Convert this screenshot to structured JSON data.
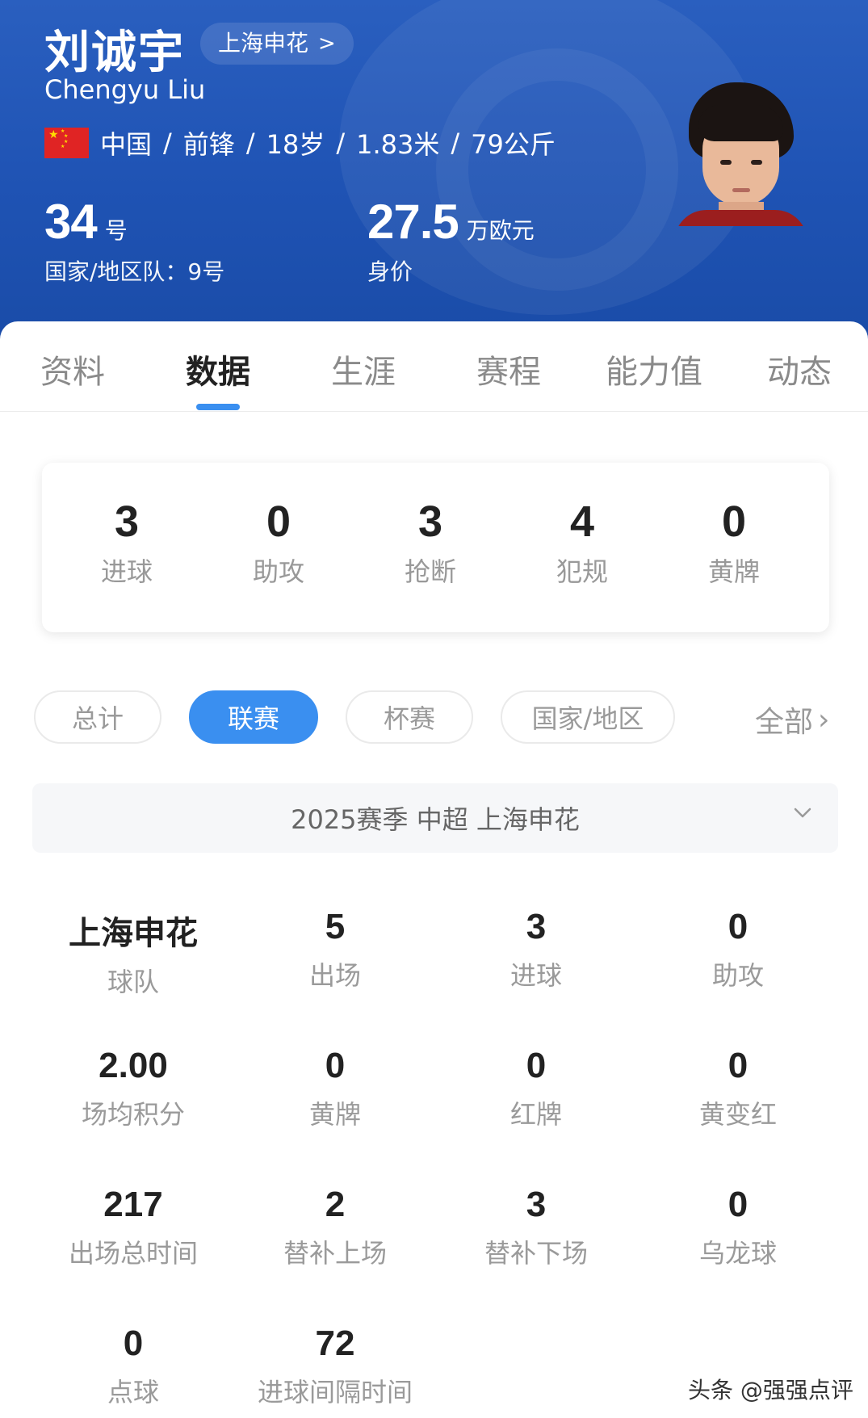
{
  "player": {
    "name_cn": "刘诚宇",
    "name_en": "Chengyu Liu",
    "club": "上海申花",
    "club_chevron": ">",
    "nationality": "中国",
    "position": "前锋",
    "age": "18岁",
    "height": "1.83米",
    "weight": "79公斤",
    "separator": "/",
    "shirt_number": "34",
    "shirt_unit": "号",
    "national_team_number": "国家/地区队：9号",
    "market_value": "27.5",
    "market_value_unit": "万欧元",
    "market_value_label": "身价"
  },
  "tabs": [
    {
      "label": "资料",
      "active": false
    },
    {
      "label": "数据",
      "active": true
    },
    {
      "label": "生涯",
      "active": false
    },
    {
      "label": "赛程",
      "active": false
    },
    {
      "label": "能力值",
      "active": false
    },
    {
      "label": "动态",
      "active": false
    }
  ],
  "summary": [
    {
      "value": "3",
      "label": "进球"
    },
    {
      "value": "0",
      "label": "助攻"
    },
    {
      "value": "3",
      "label": "抢断"
    },
    {
      "value": "4",
      "label": "犯规"
    },
    {
      "value": "0",
      "label": "黄牌"
    }
  ],
  "filters": {
    "pills": [
      {
        "label": "总计",
        "active": false
      },
      {
        "label": "联赛",
        "active": true
      },
      {
        "label": "杯赛",
        "active": false
      },
      {
        "label": "国家/地区",
        "active": false
      }
    ],
    "all_label": "全部",
    "all_chevron": "›"
  },
  "season_selector": {
    "value": "2025赛季 中超 上海申花"
  },
  "stats": [
    {
      "value": "上海申花",
      "label": "球队"
    },
    {
      "value": "5",
      "label": "出场"
    },
    {
      "value": "3",
      "label": "进球"
    },
    {
      "value": "0",
      "label": "助攻"
    },
    {
      "value": "2.00",
      "label": "场均积分"
    },
    {
      "value": "0",
      "label": "黄牌"
    },
    {
      "value": "0",
      "label": "红牌"
    },
    {
      "value": "0",
      "label": "黄变红"
    },
    {
      "value": "217",
      "label": "出场总时间"
    },
    {
      "value": "2",
      "label": "替补上场"
    },
    {
      "value": "3",
      "label": "替补下场"
    },
    {
      "value": "0",
      "label": "乌龙球"
    },
    {
      "value": "0",
      "label": "点球"
    },
    {
      "value": "72",
      "label": "进球间隔时间"
    }
  ],
  "watermark": "头条 @强强点评",
  "colors": {
    "header_bg": "#2a5fbf",
    "accent": "#3a8ff0",
    "flag_red": "#e02424",
    "flag_star": "#ffde00"
  }
}
